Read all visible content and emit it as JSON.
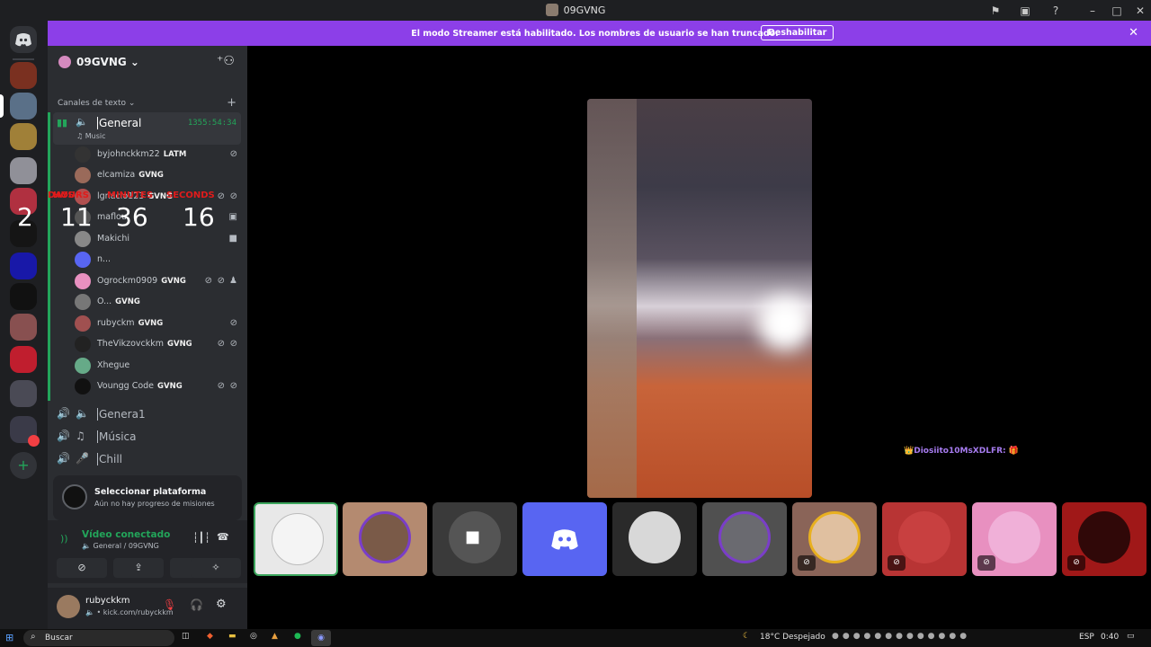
{
  "window": {
    "title": "09GVNG"
  },
  "banner": {
    "text": "El modo Streamer está habilitado. Los nombres de usuario se han truncado.",
    "button": "Deshabilitar"
  },
  "server": {
    "name": "09GVNG",
    "category": "Canales de texto"
  },
  "channels": {
    "general": {
      "name": "General",
      "subtitle": "Music",
      "timer": "1355:54:34"
    },
    "others": [
      {
        "name": "Genera1"
      },
      {
        "name": "Música"
      },
      {
        "name": "Chill"
      }
    ]
  },
  "voice_users": [
    {
      "name": "byjohnckkm22",
      "tag": "LATM"
    },
    {
      "name": "elcamiza",
      "tag": "GVNG"
    },
    {
      "name": "lgnacio123",
      "tag": "GVNG"
    },
    {
      "name": "maflou",
      "tag": ""
    },
    {
      "name": "Makichi",
      "tag": ""
    },
    {
      "name": "n...",
      "tag": ""
    },
    {
      "name": "Ogrockm0909",
      "tag": "GVNG"
    },
    {
      "name": "O...",
      "tag": "GVNG"
    },
    {
      "name": "rubyckm",
      "tag": "GVNG"
    },
    {
      "name": "TheVikzovckkm",
      "tag": "GVNG"
    },
    {
      "name": "Xhegue",
      "tag": ""
    },
    {
      "name": "Voungg Code",
      "tag": "GVNG"
    }
  ],
  "overlay_timer": {
    "labels": [
      "DAYS",
      "HOURS",
      "MINUTES",
      "SECONDS"
    ],
    "values": [
      "2",
      "11",
      "36",
      "16"
    ]
  },
  "quest": {
    "title": "Seleccionar plataforma",
    "subtitle": "Aún no hay progreso de misiones"
  },
  "connection": {
    "status": "Vídeo conectado",
    "channel": "General / 09GVNG"
  },
  "account": {
    "name": "rubyckkm",
    "status": "• kick.com/rubyckkm"
  },
  "stream": {
    "overlay_name": "Diosiito10MsXDLFR:"
  },
  "taskbar": {
    "search": "Buscar",
    "weather": "18°C  Despejado",
    "lang": "ESP",
    "time": "0:40"
  },
  "colors": {
    "accent": "#8c3fe8",
    "blurple": "#5865f2",
    "green": "#23a55a"
  }
}
